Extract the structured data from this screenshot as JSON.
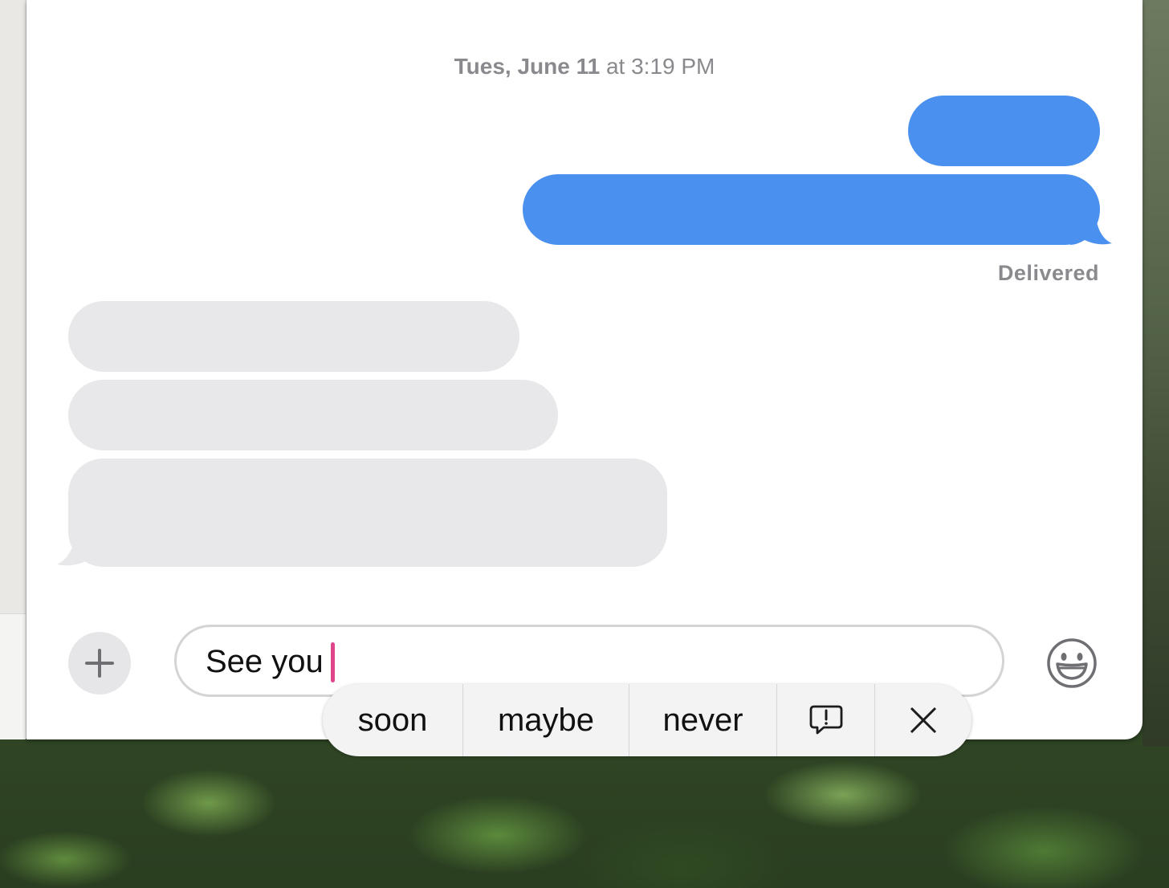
{
  "conversation": {
    "timestamp_day": "Tues, June 11",
    "timestamp_time": "at 3:19 PM",
    "delivered_status": "Delivered"
  },
  "composer": {
    "text_value": "See you "
  },
  "suggestions": [
    "soon",
    "maybe",
    "never"
  ],
  "icons": {
    "add": "plus-icon",
    "emoji": "smiley-icon",
    "report": "speech-bubble-exclamation-icon",
    "dismiss": "close-icon"
  },
  "colors": {
    "outgoing_bubble": "#4a90ef",
    "incoming_bubble": "#e8e8ea",
    "caret": "#e0458c"
  }
}
